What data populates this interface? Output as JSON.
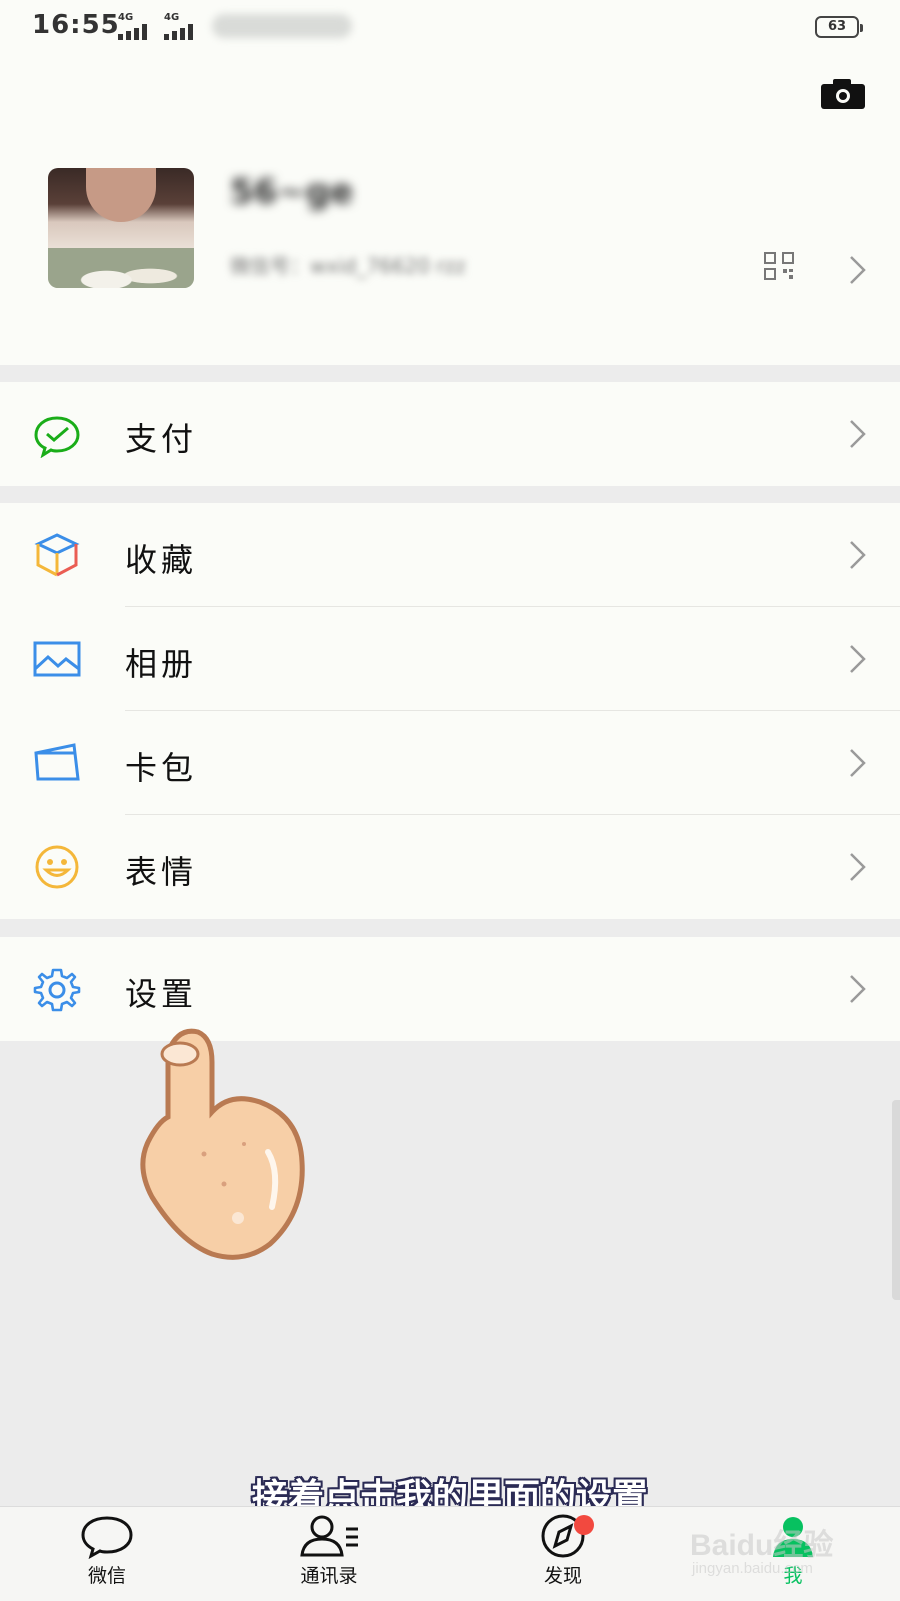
{
  "status_bar": {
    "time": "16:55",
    "network_1": "4G",
    "network_2": "4G",
    "battery": "63"
  },
  "profile": {
    "nickname": "56~ge",
    "wechat_id": "微信号：wxid_76620 rzz"
  },
  "menu_groups": [
    [
      {
        "label": "支付",
        "icon": "wechat-pay-icon"
      }
    ],
    [
      {
        "label": "收藏",
        "icon": "favorites-cube-icon"
      },
      {
        "label": "相册",
        "icon": "album-picture-icon"
      },
      {
        "label": "卡包",
        "icon": "card-wallet-icon"
      },
      {
        "label": "表情",
        "icon": "sticker-smiley-icon"
      }
    ],
    [
      {
        "label": "设置",
        "icon": "settings-gear-icon"
      }
    ]
  ],
  "subtitle": "接着点击我的里面的设置",
  "tabs": [
    {
      "label": "微信",
      "icon": "chat-bubble-icon"
    },
    {
      "label": "通讯录",
      "icon": "contacts-icon"
    },
    {
      "label": "发现",
      "icon": "compass-icon"
    },
    {
      "label": "我",
      "icon": "me-person-icon",
      "active": true
    }
  ],
  "watermark": {
    "main": "Baidu经验",
    "sub": "jingyan.baidu.com"
  },
  "colors": {
    "accent_green": "#07c160",
    "badge_red": "#f2493f",
    "page_bg": "#ececec",
    "card_bg": "#fbfcf8"
  }
}
